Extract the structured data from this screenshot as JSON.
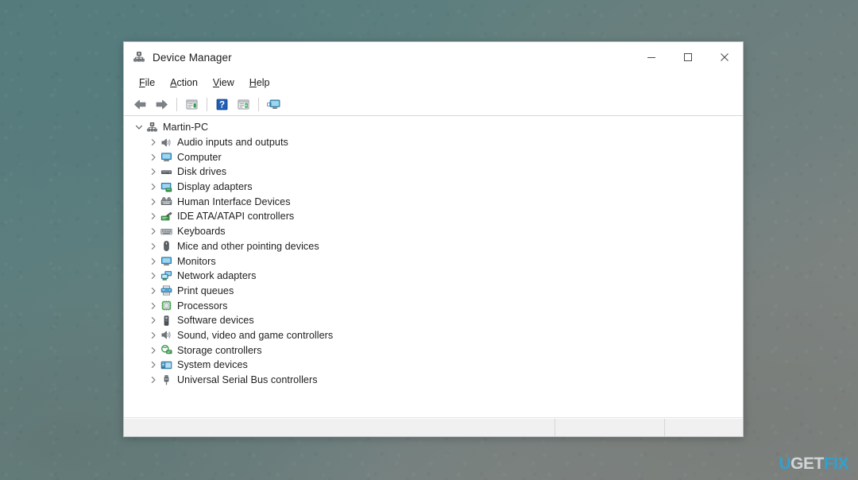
{
  "window": {
    "title": "Device Manager",
    "title_icon": "device-manager-icon",
    "controls": {
      "minimize": "─",
      "maximize": "□",
      "close": "✕"
    }
  },
  "menubar": {
    "items": [
      {
        "label": "File",
        "accel": "F"
      },
      {
        "label": "Action",
        "accel": "A"
      },
      {
        "label": "View",
        "accel": "V"
      },
      {
        "label": "Help",
        "accel": "H"
      }
    ]
  },
  "toolbar": {
    "buttons": [
      {
        "name": "back-button",
        "icon": "left-arrow-icon"
      },
      {
        "name": "forward-button",
        "icon": "right-arrow-icon"
      },
      {
        "name": "properties-button",
        "icon": "properties-window-icon"
      },
      {
        "name": "help-button",
        "icon": "question-mark-icon"
      },
      {
        "name": "scan-hardware-button",
        "icon": "scan-window-icon"
      },
      {
        "name": "show-hidden-button",
        "icon": "monitor-screen-icon"
      }
    ]
  },
  "tree": {
    "root": {
      "label": "Martin-PC",
      "icon": "computer-node-icon",
      "expanded": true,
      "twisty": "⌄"
    },
    "twisty_collapsed": "›",
    "children": [
      {
        "label": "Audio inputs and outputs",
        "icon": "speaker-icon"
      },
      {
        "label": "Computer",
        "icon": "monitor-icon"
      },
      {
        "label": "Disk drives",
        "icon": "disk-drive-icon"
      },
      {
        "label": "Display adapters",
        "icon": "display-adapter-icon"
      },
      {
        "label": "Human Interface Devices",
        "icon": "hid-icon"
      },
      {
        "label": "IDE ATA/ATAPI controllers",
        "icon": "ide-controller-icon"
      },
      {
        "label": "Keyboards",
        "icon": "keyboard-icon"
      },
      {
        "label": "Mice and other pointing devices",
        "icon": "mouse-icon"
      },
      {
        "label": "Monitors",
        "icon": "monitor-icon"
      },
      {
        "label": "Network adapters",
        "icon": "network-adapter-icon"
      },
      {
        "label": "Print queues",
        "icon": "printer-icon"
      },
      {
        "label": "Processors",
        "icon": "processor-icon"
      },
      {
        "label": "Software devices",
        "icon": "software-device-icon"
      },
      {
        "label": "Sound, video and game controllers",
        "icon": "speaker-icon"
      },
      {
        "label": "Storage controllers",
        "icon": "storage-controller-icon"
      },
      {
        "label": "System devices",
        "icon": "system-device-icon"
      },
      {
        "label": "Universal Serial Bus controllers",
        "icon": "usb-icon"
      }
    ]
  },
  "statusbar": {
    "pane1": "",
    "pane2": "",
    "pane3": ""
  },
  "watermark": {
    "part1": "U",
    "part2": "GET",
    "part3": "FIX",
    "color_accent": "#2aa5d6",
    "color_light": "#d9dde0"
  },
  "colors": {
    "desktop": "#5d7b7d",
    "window_chrome": "#ffffff",
    "statusbar": "#f0f0f0",
    "text": "#1e1e1e"
  }
}
